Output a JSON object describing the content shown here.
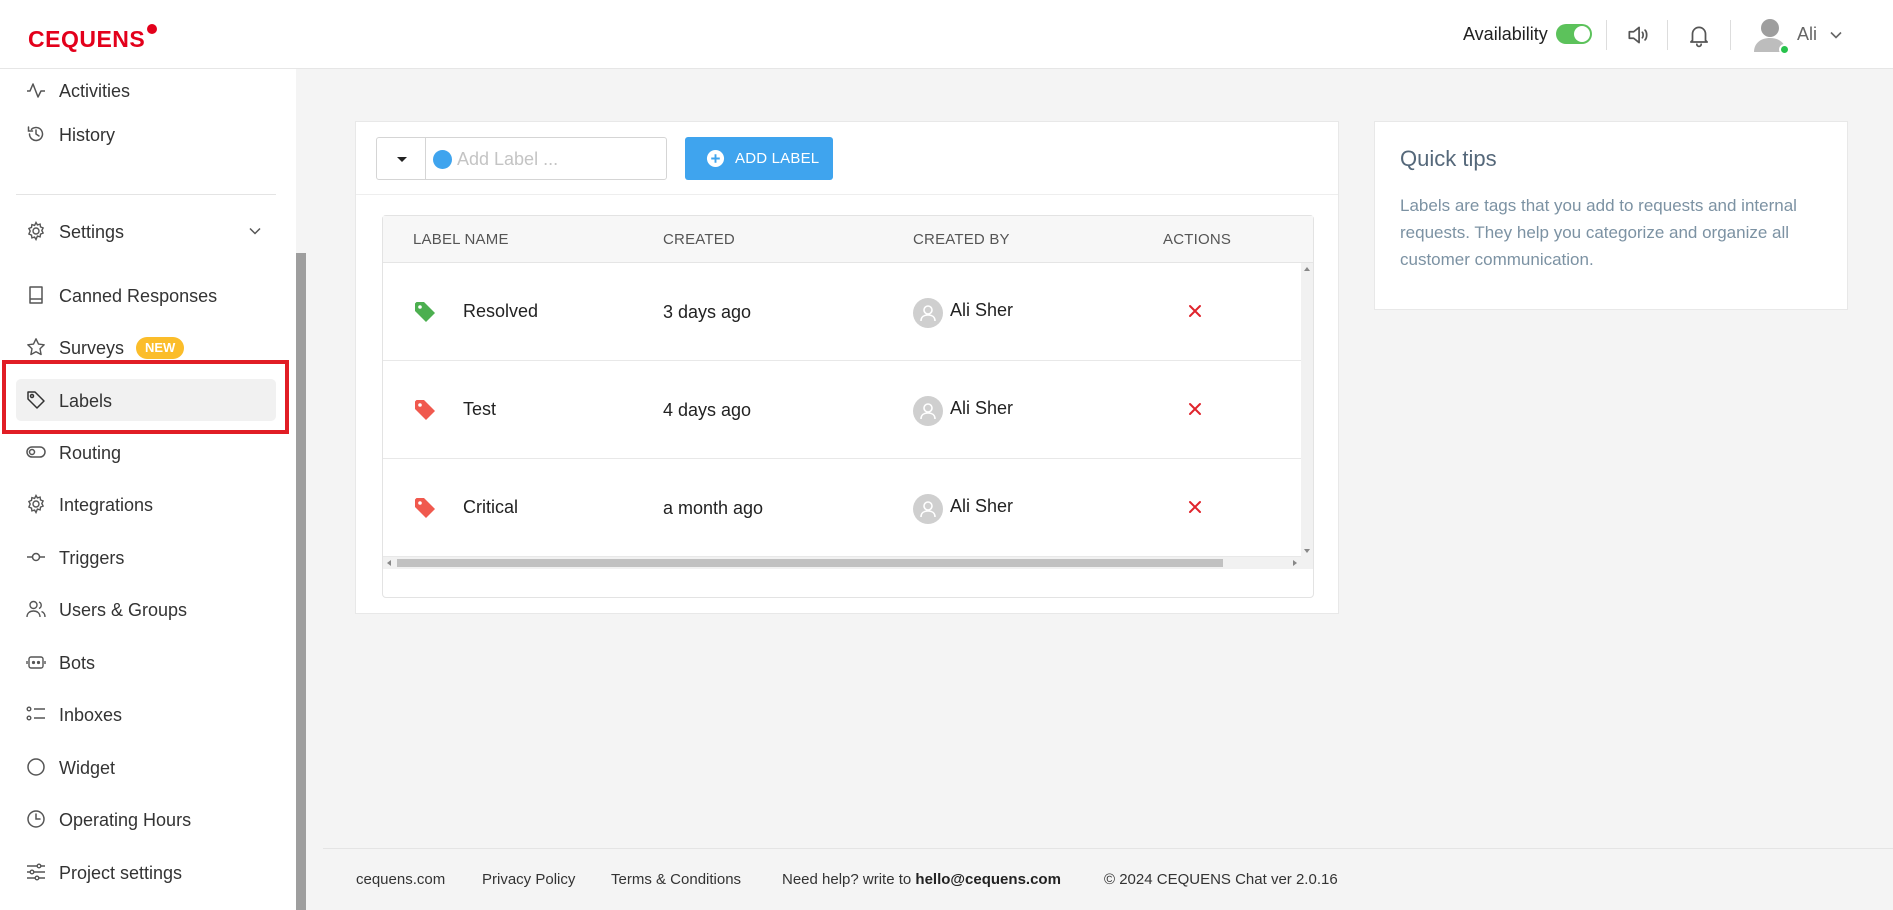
{
  "header": {
    "logo_text": "CEQUENS",
    "availability_label": "Availability",
    "availability_on": true,
    "user_name": "Ali",
    "colors": {
      "brand": "#e3001b",
      "toggle_on": "#5cc25b",
      "online": "#27c24c"
    }
  },
  "sidebar": {
    "items": [
      {
        "label": "Activities",
        "icon": "activity-icon"
      },
      {
        "label": "History",
        "icon": "history-icon"
      },
      {
        "label": "Settings",
        "icon": "gear-icon"
      },
      {
        "label": "Canned Responses",
        "icon": "book-icon"
      },
      {
        "label": "Surveys",
        "icon": "star-icon",
        "badge": "NEW"
      },
      {
        "label": "Labels",
        "icon": "tag-icon",
        "active": true
      },
      {
        "label": "Routing",
        "icon": "toggle-icon"
      },
      {
        "label": "Integrations",
        "icon": "cog-icon"
      },
      {
        "label": "Triggers",
        "icon": "commit-icon"
      },
      {
        "label": "Users & Groups",
        "icon": "users-icon"
      },
      {
        "label": "Bots",
        "icon": "bot-icon"
      },
      {
        "label": "Inboxes",
        "icon": "list-icon"
      },
      {
        "label": "Widget",
        "icon": "circle-icon"
      },
      {
        "label": "Operating Hours",
        "icon": "clock-icon"
      },
      {
        "label": "Project settings",
        "icon": "sliders-icon"
      }
    ]
  },
  "toolbar": {
    "label_placeholder": "Add Label ...",
    "label_value": "",
    "selected_color": "#3fa4ee",
    "add_button_label": "ADD LABEL"
  },
  "table": {
    "columns": [
      "LABEL NAME",
      "CREATED",
      "CREATED BY",
      "ACTIONS"
    ],
    "rows": [
      {
        "name": "Resolved",
        "created": "3 days ago",
        "created_by": "Ali Sher",
        "tag_color": "#4caf50"
      },
      {
        "name": "Test",
        "created": "4 days ago",
        "created_by": "Ali Sher",
        "tag_color": "#f0594e"
      },
      {
        "name": "Critical",
        "created": "a month ago",
        "created_by": "Ali Sher",
        "tag_color": "#f0594e"
      }
    ]
  },
  "tips": {
    "title": "Quick tips",
    "body": "Labels are tags that you add to requests and internal requests. They help you categorize and organize all customer communication."
  },
  "footer": {
    "site": "cequens.com",
    "privacy": "Privacy Policy",
    "terms": "Terms & Conditions",
    "help_prefix": "Need help? write to",
    "help_email": "hello@cequens.com",
    "copyright": "© 2024 CEQUENS Chat ver 2.0.16"
  }
}
